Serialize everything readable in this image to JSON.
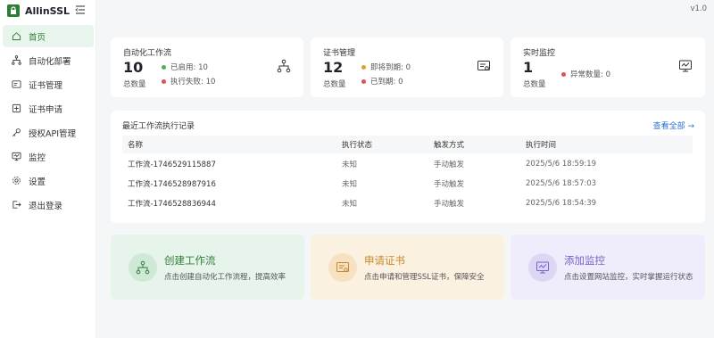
{
  "app": {
    "name": "AllinSSL",
    "version": "v1.0"
  },
  "colors": {
    "accent": "#2e7d32",
    "active_bg": "#e8f5ec",
    "success": "#4caf50",
    "danger": "#d9534f",
    "warning": "#e0a030",
    "link": "#2f6fd6"
  },
  "sidebar": {
    "items": [
      {
        "label": "首页",
        "icon": "home-icon"
      },
      {
        "label": "自动化部署",
        "icon": "workflow-icon"
      },
      {
        "label": "证书管理",
        "icon": "certificate-icon"
      },
      {
        "label": "证书申请",
        "icon": "apply-icon"
      },
      {
        "label": "授权API管理",
        "icon": "key-icon"
      },
      {
        "label": "监控",
        "icon": "monitor-icon"
      },
      {
        "label": "设置",
        "icon": "gear-icon"
      },
      {
        "label": "退出登录",
        "icon": "logout-icon"
      }
    ]
  },
  "stats": {
    "workflow": {
      "title": "自动化工作流",
      "count": "10",
      "sub": "总数量",
      "enabled": "已启用: 10",
      "failed": "执行失败: 10"
    },
    "cert": {
      "title": "证书管理",
      "count": "12",
      "sub": "总数量",
      "expiring": "即将到期: 0",
      "expired": "已到期: 0"
    },
    "monitor": {
      "title": "实时监控",
      "count": "1",
      "sub": "总数量",
      "abnormal": "异常数量: 0"
    }
  },
  "history": {
    "title": "最近工作流执行记录",
    "view_all": "查看全部 →",
    "headers": [
      "名称",
      "执行状态",
      "触发方式",
      "执行时间"
    ],
    "rows": [
      [
        "工作流-1746529115887",
        "未知",
        "手动触发",
        "2025/5/6 18:59:19"
      ],
      [
        "工作流-1746528987916",
        "未知",
        "手动触发",
        "2025/5/6 18:57:03"
      ],
      [
        "工作流-1746528836944",
        "未知",
        "手动触发",
        "2025/5/6 18:54:39"
      ]
    ]
  },
  "actions": {
    "workflow": {
      "title": "创建工作流",
      "desc": "点击创建自动化工作流程，提高效率"
    },
    "cert": {
      "title": "申请证书",
      "desc": "点击申请和管理SSL证书，保障安全"
    },
    "monitor": {
      "title": "添加监控",
      "desc": "点击设置网站监控，实时掌握运行状态"
    }
  }
}
